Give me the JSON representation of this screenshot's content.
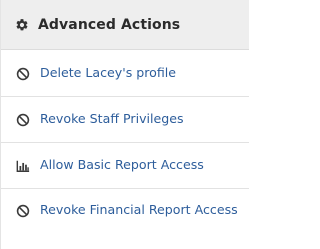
{
  "panel": {
    "title": "Advanced Actions",
    "title_icon": "gear-icon",
    "colors": {
      "header_bg": "#eeeeee",
      "link": "#2d5d9b",
      "icon": "#3a3a3a"
    }
  },
  "actions": [
    {
      "label": "Delete Lacey's profile",
      "icon": "ban-icon"
    },
    {
      "label": "Revoke Staff Privileges",
      "icon": "ban-icon"
    },
    {
      "label": "Allow Basic Report Access",
      "icon": "bar-chart-icon"
    },
    {
      "label": "Revoke Financial Report Access",
      "icon": "ban-icon"
    }
  ]
}
